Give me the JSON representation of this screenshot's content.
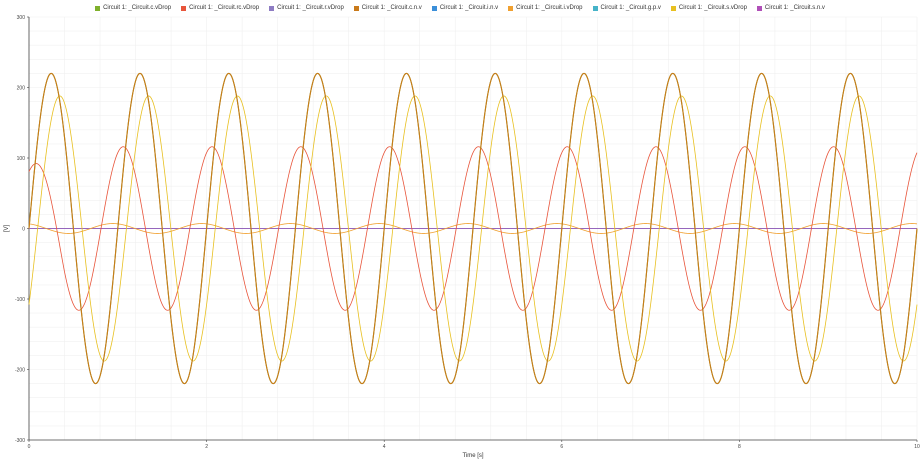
{
  "chart_data": {
    "type": "line",
    "xlabel": "Time [s]",
    "ylabel": "[V]",
    "xlim": [
      0,
      10
    ],
    "ylim": [
      -300,
      300
    ],
    "xticks": [
      0,
      2,
      4,
      6,
      8,
      10
    ],
    "yticks": [
      -300,
      -200,
      -100,
      0,
      100,
      200,
      300
    ],
    "grid": true,
    "legend_position": "top",
    "series": [
      {
        "name": "Circuit 1: _Circuit.c.vDrop",
        "color": "#7fb02c",
        "amplitude": 220,
        "phase_deg": 0,
        "offset": 0
      },
      {
        "name": "Circuit 1: _Circuit.rc.vDrop",
        "color": "#e8553b",
        "amplitude": 116,
        "phase_deg": 68,
        "offset": 0
      },
      {
        "name": "Circuit 1: _Circuit.r.vDrop",
        "color": "#8e7cc3",
        "amplitude": 0,
        "phase_deg": 0,
        "offset": 0
      },
      {
        "name": "Circuit 1: _Circuit.c.n.v",
        "color": "#c97a1a",
        "amplitude": 220,
        "phase_deg": 0,
        "offset": 0
      },
      {
        "name": "Circuit 1: _Circuit.i.n.v",
        "color": "#3b8fd9",
        "amplitude": 0,
        "phase_deg": 0,
        "offset": 0
      },
      {
        "name": "Circuit 1: _Circuit.i.vDrop",
        "color": "#f0a030",
        "amplitude": 7,
        "phase_deg": 110,
        "offset": 0
      },
      {
        "name": "Circuit 1: _Circuit.g.p.v",
        "color": "#46b3c8",
        "amplitude": 0,
        "phase_deg": 0,
        "offset": 0
      },
      {
        "name": "Circuit 1: _Circuit.s.vDrop",
        "color": "#e8c020",
        "amplitude": 188,
        "phase_deg": -35,
        "offset": 0
      },
      {
        "name": "Circuit 1: _Circuit.s.n.v",
        "color": "#b04fb8",
        "amplitude": 0,
        "phase_deg": 0,
        "offset": 0
      }
    ],
    "frequency_hz": 1
  }
}
